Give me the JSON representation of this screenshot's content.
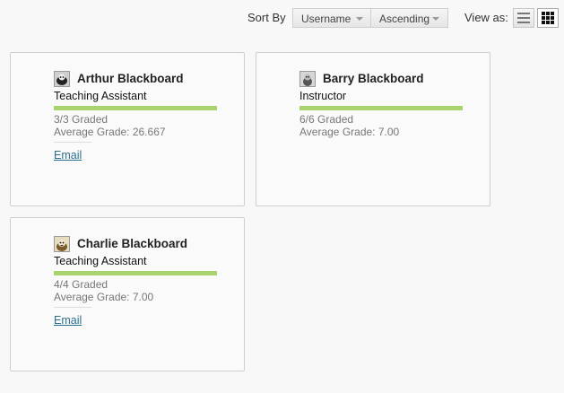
{
  "toolbar": {
    "sort_by_label": "Sort By",
    "sort_field": "Username",
    "sort_order": "Ascending",
    "view_as_label": "View as:"
  },
  "members": [
    {
      "name": "Arthur Blackboard",
      "role": "Teaching Assistant",
      "graded": "3/3 Graded",
      "average": "Average Grade: 26.667",
      "email_label": "Email",
      "progress": 1.0
    },
    {
      "name": "Barry Blackboard",
      "role": "Instructor",
      "graded": "6/6 Graded",
      "average": "Average Grade: 7.00",
      "email_label": "",
      "progress": 1.0
    },
    {
      "name": "Charlie Blackboard",
      "role": "Teaching Assistant",
      "graded": "4/4 Graded",
      "average": "Average Grade: 7.00",
      "email_label": "Email",
      "progress": 1.0
    }
  ],
  "colors": {
    "progress_bar": "#a8d46f",
    "link": "#2a6f8e"
  }
}
